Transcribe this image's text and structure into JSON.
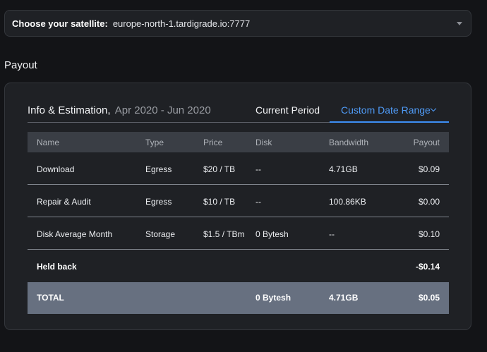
{
  "satellite": {
    "label": "Choose your satellite:",
    "value": "europe-north-1.tardigrade.io:7777"
  },
  "section_title": "Payout",
  "card": {
    "title": "Info & Estimation,",
    "period": "Apr 2020 - Jun 2020",
    "tabs": {
      "current": "Current Period",
      "custom": "Custom Date Range"
    }
  },
  "table": {
    "headers": [
      "Name",
      "Type",
      "Price",
      "Disk",
      "Bandwidth",
      "Payout"
    ],
    "rows": [
      {
        "name": "Download",
        "type": "Egress",
        "price": "$20 / TB",
        "disk": "--",
        "bandwidth": "4.71GB",
        "payout": "$0.09"
      },
      {
        "name": "Repair & Audit",
        "type": "Egress",
        "price": "$10 / TB",
        "disk": "--",
        "bandwidth": "100.86KB",
        "payout": "$0.00"
      },
      {
        "name": "Disk Average Month",
        "type": "Storage",
        "price": "$1.5 / TBm",
        "disk": "0 Bytesh",
        "bandwidth": "--",
        "payout": "$0.10"
      }
    ],
    "held_back": {
      "name": "Held back",
      "payout": "-$0.14"
    },
    "total": {
      "name": "TOTAL",
      "disk": "0 Bytesh",
      "bandwidth": "4.71GB",
      "payout": "$0.05"
    }
  },
  "colors": {
    "background": "#131417",
    "card": "#1f2125",
    "accent": "#4f9bf7",
    "total_row": "#677080"
  },
  "icons": {
    "satellite_dropdown": "caret-down-icon",
    "custom_range": "chevron-down-icon"
  }
}
